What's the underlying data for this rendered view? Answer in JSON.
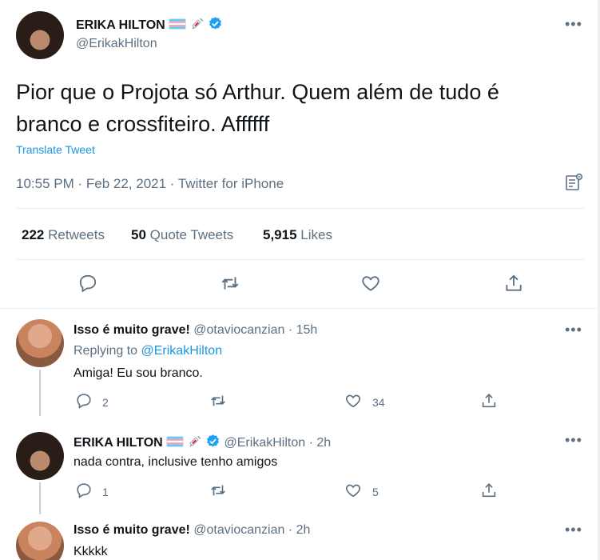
{
  "main_tweet": {
    "name": "ERIKA HILTON",
    "handle": "@ErikakHilton",
    "text_line1": "Pior que o Projota só Arthur. Quem além de tudo é",
    "text_line2": "branco e crossfiteiro. Affffff",
    "translate_label": "Translate Tweet",
    "timestamp": "10:55 PM · Feb 22, 2021 · Twitter for iPhone",
    "stats": {
      "retweets_count": "222",
      "retweets_label": "Retweets",
      "quotes_count": "50",
      "quotes_label": "Quote Tweets",
      "likes_count": "5,915",
      "likes_label": "Likes"
    },
    "more_label": "•••"
  },
  "replies": [
    {
      "name": "Isso é muito grave!",
      "handle": "@otaviocanzian",
      "time": "· 15h",
      "replying_prefix": "Replying to",
      "replying_handle": "@ErikakHilton",
      "text": "Amiga! Eu sou branco.",
      "reply_count": "2",
      "like_count": "34",
      "more_label": "•••"
    },
    {
      "name": "ERIKA HILTON",
      "handle": "@ErikakHilton",
      "time": "· 2h",
      "text": "nada contra, inclusive tenho amigos",
      "reply_count": "1",
      "like_count": "5",
      "more_label": "•••"
    },
    {
      "name": "Isso é muito grave!",
      "handle": "@otaviocanzian",
      "time": "· 2h",
      "text": "Kkkkk",
      "more_label": "•••"
    }
  ],
  "icons": {
    "reply": "reply-icon",
    "retweet": "retweet-icon",
    "like": "heart-icon",
    "share": "share-icon",
    "analytics": "analytics-icon",
    "verified": "verified-badge-icon"
  },
  "colors": {
    "accent": "#1b95e0",
    "secondary_text": "#5b7083",
    "divider": "#ebeef0"
  }
}
